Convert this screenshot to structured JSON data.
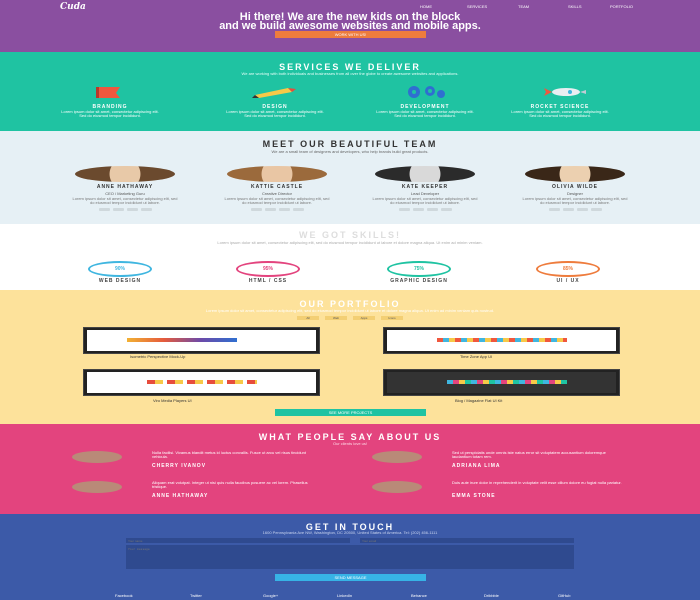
{
  "hero": {
    "logo": "Cuda",
    "nav": [
      "Home",
      "Services",
      "Team",
      "Skills",
      "Portfolio"
    ],
    "title_line1": "Hi there! We are the new kids on the block",
    "title_line2": "and we build awesome websites and mobile apps.",
    "cta": "WORK WITH US!"
  },
  "services": {
    "title": "Services we deliver",
    "subtitle": "We are working with both individuals and businesses from all over the globe to create awesome websites and applications.",
    "items": [
      {
        "title": "Branding",
        "desc": "Lorem ipsum dolor sit amet, consectetur adipiscing elit. Sed do eiusmod tempor incididunt."
      },
      {
        "title": "Design",
        "desc": "Lorem ipsum dolor sit amet, consectetur adipiscing elit. Sed do eiusmod tempor incididunt."
      },
      {
        "title": "Development",
        "desc": "Lorem ipsum dolor sit amet, consectetur adipiscing elit. Sed do eiusmod tempor incididunt."
      },
      {
        "title": "Rocket Science",
        "desc": "Lorem ipsum dolor sit amet, consectetur adipiscing elit. Sed do eiusmod tempor incididunt."
      }
    ]
  },
  "team": {
    "title": "Meet our beautiful team",
    "subtitle": "We are a small team of designers and developers, who help brands build great products.",
    "members": [
      {
        "name": "Anne Hathaway",
        "role": "CEO / Marketing Guru",
        "bio": "Lorem ipsum dolor sit amet, consectetur adipiscing elit, sed do eiusmod tempor incididunt ut labore."
      },
      {
        "name": "Kattie Castle",
        "role": "Creative Director",
        "bio": "Lorem ipsum dolor sit amet, consectetur adipiscing elit, sed do eiusmod tempor incididunt ut labore."
      },
      {
        "name": "Kate Keeper",
        "role": "Lead Developer",
        "bio": "Lorem ipsum dolor sit amet, consectetur adipiscing elit, sed do eiusmod tempor incididunt ut labore."
      },
      {
        "name": "Olivia Wilde",
        "role": "Designer",
        "bio": "Lorem ipsum dolor sit amet, consectetur adipiscing elit, sed do eiusmod tempor incididunt ut labore."
      }
    ]
  },
  "skills": {
    "title": "We got skills!",
    "subtitle": "Lorem ipsum dolor sit amet, consectetur adipiscing elit, sed do eiusmod tempor incididunt ut labore et dolore magna aliqua. Ut enim ad minim veniam.",
    "items": [
      {
        "label": "Web design",
        "value": "90%",
        "color": "#3fb6e0"
      },
      {
        "label": "HTML / CSS",
        "value": "95%",
        "color": "#e3447e"
      },
      {
        "label": "Graphic design",
        "value": "75%",
        "color": "#1fc3a2"
      },
      {
        "label": "UI / UX",
        "value": "85%",
        "color": "#ee7c3d"
      }
    ]
  },
  "portfolio": {
    "title": "Our Portfolio",
    "subtitle": "Lorem ipsum dolor sit amet, consectetur adipiscing elit, sed do eiusmod tempor incididunt ut labore et dolore magna aliqua. Ut enim ad minim veniam quis nostrud.",
    "filters": [
      "All",
      "Web",
      "Apps",
      "Icons"
    ],
    "captions": [
      "Isometric Perspective Mock-Up",
      "Time Zone App UI",
      "Viro Media Players UI",
      "Blog / Magazine Flat UI Kit"
    ],
    "cta": "SEE MORE PROJECTS"
  },
  "testimonials": {
    "title": "What people say about us",
    "subtitle": "Our clients love us!",
    "items": [
      {
        "quote": "Nulla facilisi. Vivamus blandit metus id luctus convallis. Fusce ut arcu vel risus tincidunt vehicula.",
        "name": "Cherry Ivanov"
      },
      {
        "quote": "Sed ut perspiciatis unde omnis iste natus error sit voluptatem accusantium doloremque laudantium totam rem.",
        "name": "Adriana Lima"
      },
      {
        "quote": "Aliquam erat volutpat. Integer ut nisi quis nulla faucibus posuere ac vel lorem. Phasellus tristique.",
        "name": "Anne Hathaway"
      },
      {
        "quote": "Duis aute irure dolor in reprehenderit in voluptate velit esse cillum dolore eu fugiat nulla pariatur.",
        "name": "Emma Stone"
      }
    ]
  },
  "contact": {
    "title": "Get in touch",
    "info": "1600 Pennsylvania Ave NW, Washington, DC 20500, United States of America. Tel: (202) 456-1111",
    "name_placeholder": "Your name",
    "email_placeholder": "Your email",
    "message_placeholder": "Your message",
    "cta": "SEND MESSAGE",
    "footer": [
      "Facebook",
      "Twitter",
      "Google+",
      "LinkedIn",
      "Behance",
      "Dribbble",
      "GitHub"
    ]
  },
  "colors": {
    "hero": "#8a4fa0",
    "services": "#1fc3a2",
    "team": "#e6f0f5",
    "portfolio": "#fde29b",
    "testimonials": "#e3447e",
    "contact": "#3c5aa8",
    "accent_orange": "#ee7c3d"
  }
}
